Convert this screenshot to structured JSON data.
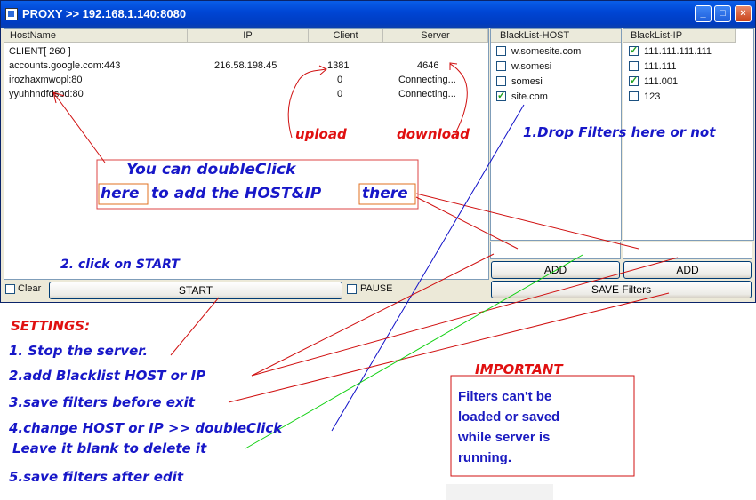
{
  "window": {
    "title": "PROXY  >> 192.168.1.140:8080",
    "minimize_label": "_",
    "maximize_label": "□",
    "close_label": "×"
  },
  "connections": {
    "headers": [
      "HostName",
      "IP",
      "Client",
      "Server"
    ],
    "rows": [
      {
        "host": "CLIENT[ 260 ]",
        "ip": "",
        "client": "",
        "server": ""
      },
      {
        "host": "accounts.google.com:443",
        "ip": "216.58.198.45",
        "client": "1381",
        "server": "4646"
      },
      {
        "host": "irozhaxmwopl:80",
        "ip": "",
        "client": "0",
        "server": "Connecting..."
      },
      {
        "host": "yyuhhndfdsbd:80",
        "ip": "",
        "client": "0",
        "server": "Connecting..."
      }
    ]
  },
  "blacklist_host": {
    "header": "BlackList-HOST",
    "items": [
      {
        "label": "w.somesite.com",
        "checked": false
      },
      {
        "label": "w.somesi",
        "checked": false
      },
      {
        "label": "somesi",
        "checked": false
      },
      {
        "label": "site.com",
        "checked": true
      }
    ],
    "input_value": "",
    "add_label": "ADD"
  },
  "blacklist_ip": {
    "header": "BlackList-IP",
    "items": [
      {
        "label": "111.111.111.111",
        "checked": true
      },
      {
        "label": "111.111",
        "checked": false
      },
      {
        "label": "111.001",
        "checked": true
      },
      {
        "label": "123",
        "checked": false
      }
    ],
    "input_value": "",
    "add_label": "ADD"
  },
  "controls": {
    "clear_label": "Clear",
    "start_label": "START",
    "pause_label": "PAUSE",
    "save_filters_label": "SAVE Filters"
  },
  "annotations": {
    "upload": "upload",
    "download": "download",
    "drop_filters": "1.Drop Filters here or not",
    "double_click_line1": "You can doubleClick",
    "double_click_here": "here",
    "double_click_middle": "to add the HOST&IP",
    "double_click_there": "there",
    "click_start": "2. click on START",
    "settings_title": "SETTINGS:",
    "step1": "1. Stop the server.",
    "step2": "2.add Blacklist HOST or IP",
    "step3": "3.save filters before exit",
    "step4": "4.change HOST or IP >> doubleClick",
    "step4b": "Leave it blank to delete it",
    "step5": "5.save filters after edit",
    "important_title": "IMPORTANT",
    "important_text": [
      "Filters can't be",
      "loaded or saved",
      "while server is",
      "running."
    ]
  },
  "colors": {
    "annotation_blue": "#1717c8",
    "annotation_red": "#e01010",
    "titlebar": "#0046d5"
  }
}
